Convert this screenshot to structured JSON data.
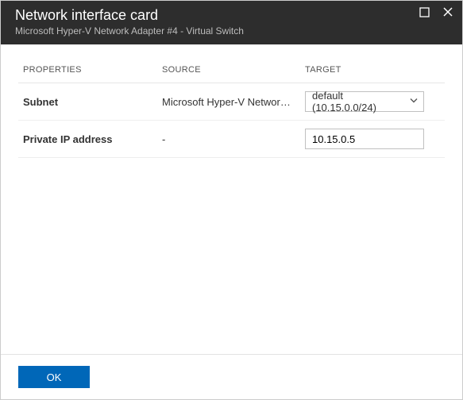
{
  "header": {
    "title": "Network interface card",
    "subtitle": "Microsoft Hyper-V Network Adapter #4 - Virtual Switch"
  },
  "table": {
    "headers": {
      "properties": "PROPERTIES",
      "source": "SOURCE",
      "target": "TARGET"
    },
    "rows": [
      {
        "property": "Subnet",
        "source": "Microsoft Hyper-V Network A...",
        "target": "default (10.15.0.0/24)"
      },
      {
        "property": "Private IP address",
        "source": "-",
        "target": "10.15.0.5"
      }
    ]
  },
  "footer": {
    "ok_label": "OK"
  },
  "colors": {
    "header_bg": "#2d2d2d",
    "primary": "#0067b8"
  }
}
